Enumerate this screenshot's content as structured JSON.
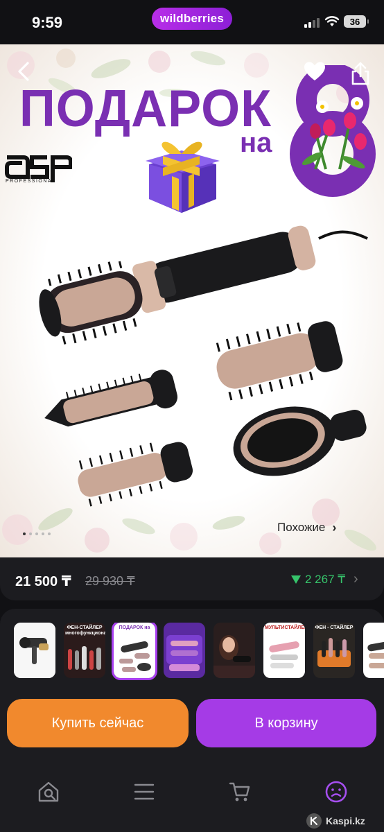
{
  "status_bar": {
    "time": "9:59",
    "brand": "wildberries",
    "battery": "36"
  },
  "hero": {
    "promo_title": "ПОДАРОК",
    "promo_na": "на",
    "brand_logo": "dsp",
    "brand_logo_sub": "PROFESSIONAL",
    "similar_label": "Похожие",
    "image_index": 1,
    "image_count": 5,
    "icons": [
      "back-icon",
      "heart-icon",
      "share-icon",
      "gift-icon",
      "chevron-right-icon"
    ]
  },
  "price": {
    "current": "21 500 ₸",
    "old": "29 930 ₸",
    "cashback": "2 267 ₸",
    "cashback_color": "#36c46b"
  },
  "thumbnails": [
    {
      "label": "",
      "selected": false
    },
    {
      "label": "ФЕН-СТАЙЛЕР многофункциональный",
      "selected": false
    },
    {
      "label": "ПОДАРОК на",
      "selected": true
    },
    {
      "label": "",
      "selected": false
    },
    {
      "label": "",
      "selected": false
    },
    {
      "label": "МУЛЬТИСТАЙЛЕР",
      "selected": false
    },
    {
      "label": "ФЕН - СТАЙЛЕР",
      "selected": false
    },
    {
      "label": "",
      "selected": false
    }
  ],
  "actions": {
    "buy_now": "Купить сейчас",
    "add_to_cart": "В корзину",
    "buy_now_color": "#f1892d",
    "add_to_cart_color": "#a53be6"
  },
  "navbar": {
    "items": [
      "home-search-icon",
      "menu-icon",
      "cart-icon",
      "profile-icon"
    ],
    "active": "profile-icon"
  },
  "watermark": "Kaspi.kz"
}
